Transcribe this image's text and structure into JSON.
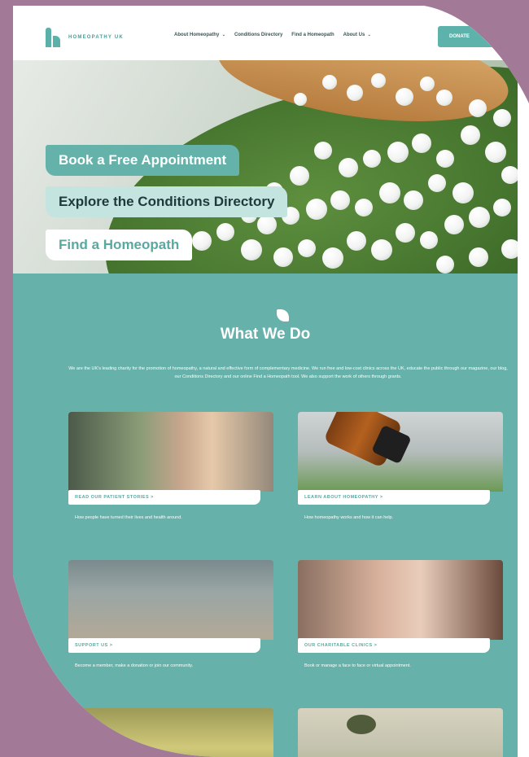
{
  "site": {
    "logo_text": "HOMEOPATHY UK",
    "nav": [
      {
        "label": "About Homeopathy",
        "has_dropdown": true
      },
      {
        "label": "Conditions Directory",
        "has_dropdown": false
      },
      {
        "label": "Find a Homeopath",
        "has_dropdown": false
      },
      {
        "label": "About Us",
        "has_dropdown": true
      }
    ],
    "donate_label": "DONATE",
    "accent": "#5db3ab",
    "frame_color": "#a27997"
  },
  "hero": {
    "cta_primary": "Book a Free Appointment",
    "cta_secondary": "Explore the Conditions Directory",
    "cta_tertiary": "Find a Homeopath"
  },
  "what_we_do": {
    "title": "What We Do",
    "description": "We are the UK's leading charity for the promotion of homeopathy, a natural and effective form of complementary medicine. We run free and low-cost clinics across the UK, educate the public through our magazine, our blog, our Conditions Directory and our online Find a Homeopath tool. We also support the work of others through grants.",
    "cards": [
      {
        "label": "READ OUR PATIENT STORIES  >",
        "desc": "How people have turned their lives and health around."
      },
      {
        "label": "LEARN ABOUT HOMEOPATHY  >",
        "desc": "How homeopathy works and how it can help."
      },
      {
        "label": "SUPPORT US  >",
        "desc": "Become a member, make a donation or join our community."
      },
      {
        "label": "OUR CHARITABLE CLINICS  >",
        "desc": "Book or manage a face to face or virtual appointment."
      }
    ]
  }
}
